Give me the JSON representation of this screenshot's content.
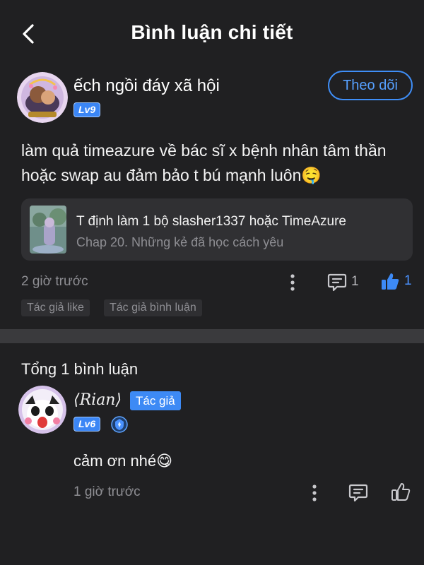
{
  "header": {
    "title": "Bình luận chi tiết"
  },
  "post": {
    "username": "ếch ngồi đáy xã hội",
    "level": "Lv9",
    "follow_label": "Theo dõi",
    "text": "làm quả timeazure về bác sĩ x bệnh nhân tâm thần hoặc swap au đảm bảo t bú mạnh luôn🤤",
    "story": {
      "title": "T định làm 1 bộ slasher1337 hoặc TimeAzure",
      "chapter": "Chap 20. Những kẻ đã học cách yêu"
    },
    "time": "2 giờ trước",
    "comment_count": "1",
    "like_count": "1",
    "tags": [
      "Tác giả like",
      "Tác giả bình luận"
    ]
  },
  "comments": {
    "total": "Tổng 1 bình luận",
    "items": [
      {
        "name": "Rian",
        "badge": "Tác giả",
        "level": "Lv6",
        "text": "cảm ơn nhé😋",
        "time": "1 giờ trước"
      }
    ]
  },
  "colors": {
    "background": "#202022",
    "accent": "#3f8ef7",
    "muted": "#8e8e93",
    "card": "#303033",
    "divider": "#3a3a3d"
  },
  "icons": [
    "back-arrow-icon",
    "more-vertical-icon",
    "comment-icon",
    "thumbs-up-icon",
    "vip-shield-icon"
  ]
}
